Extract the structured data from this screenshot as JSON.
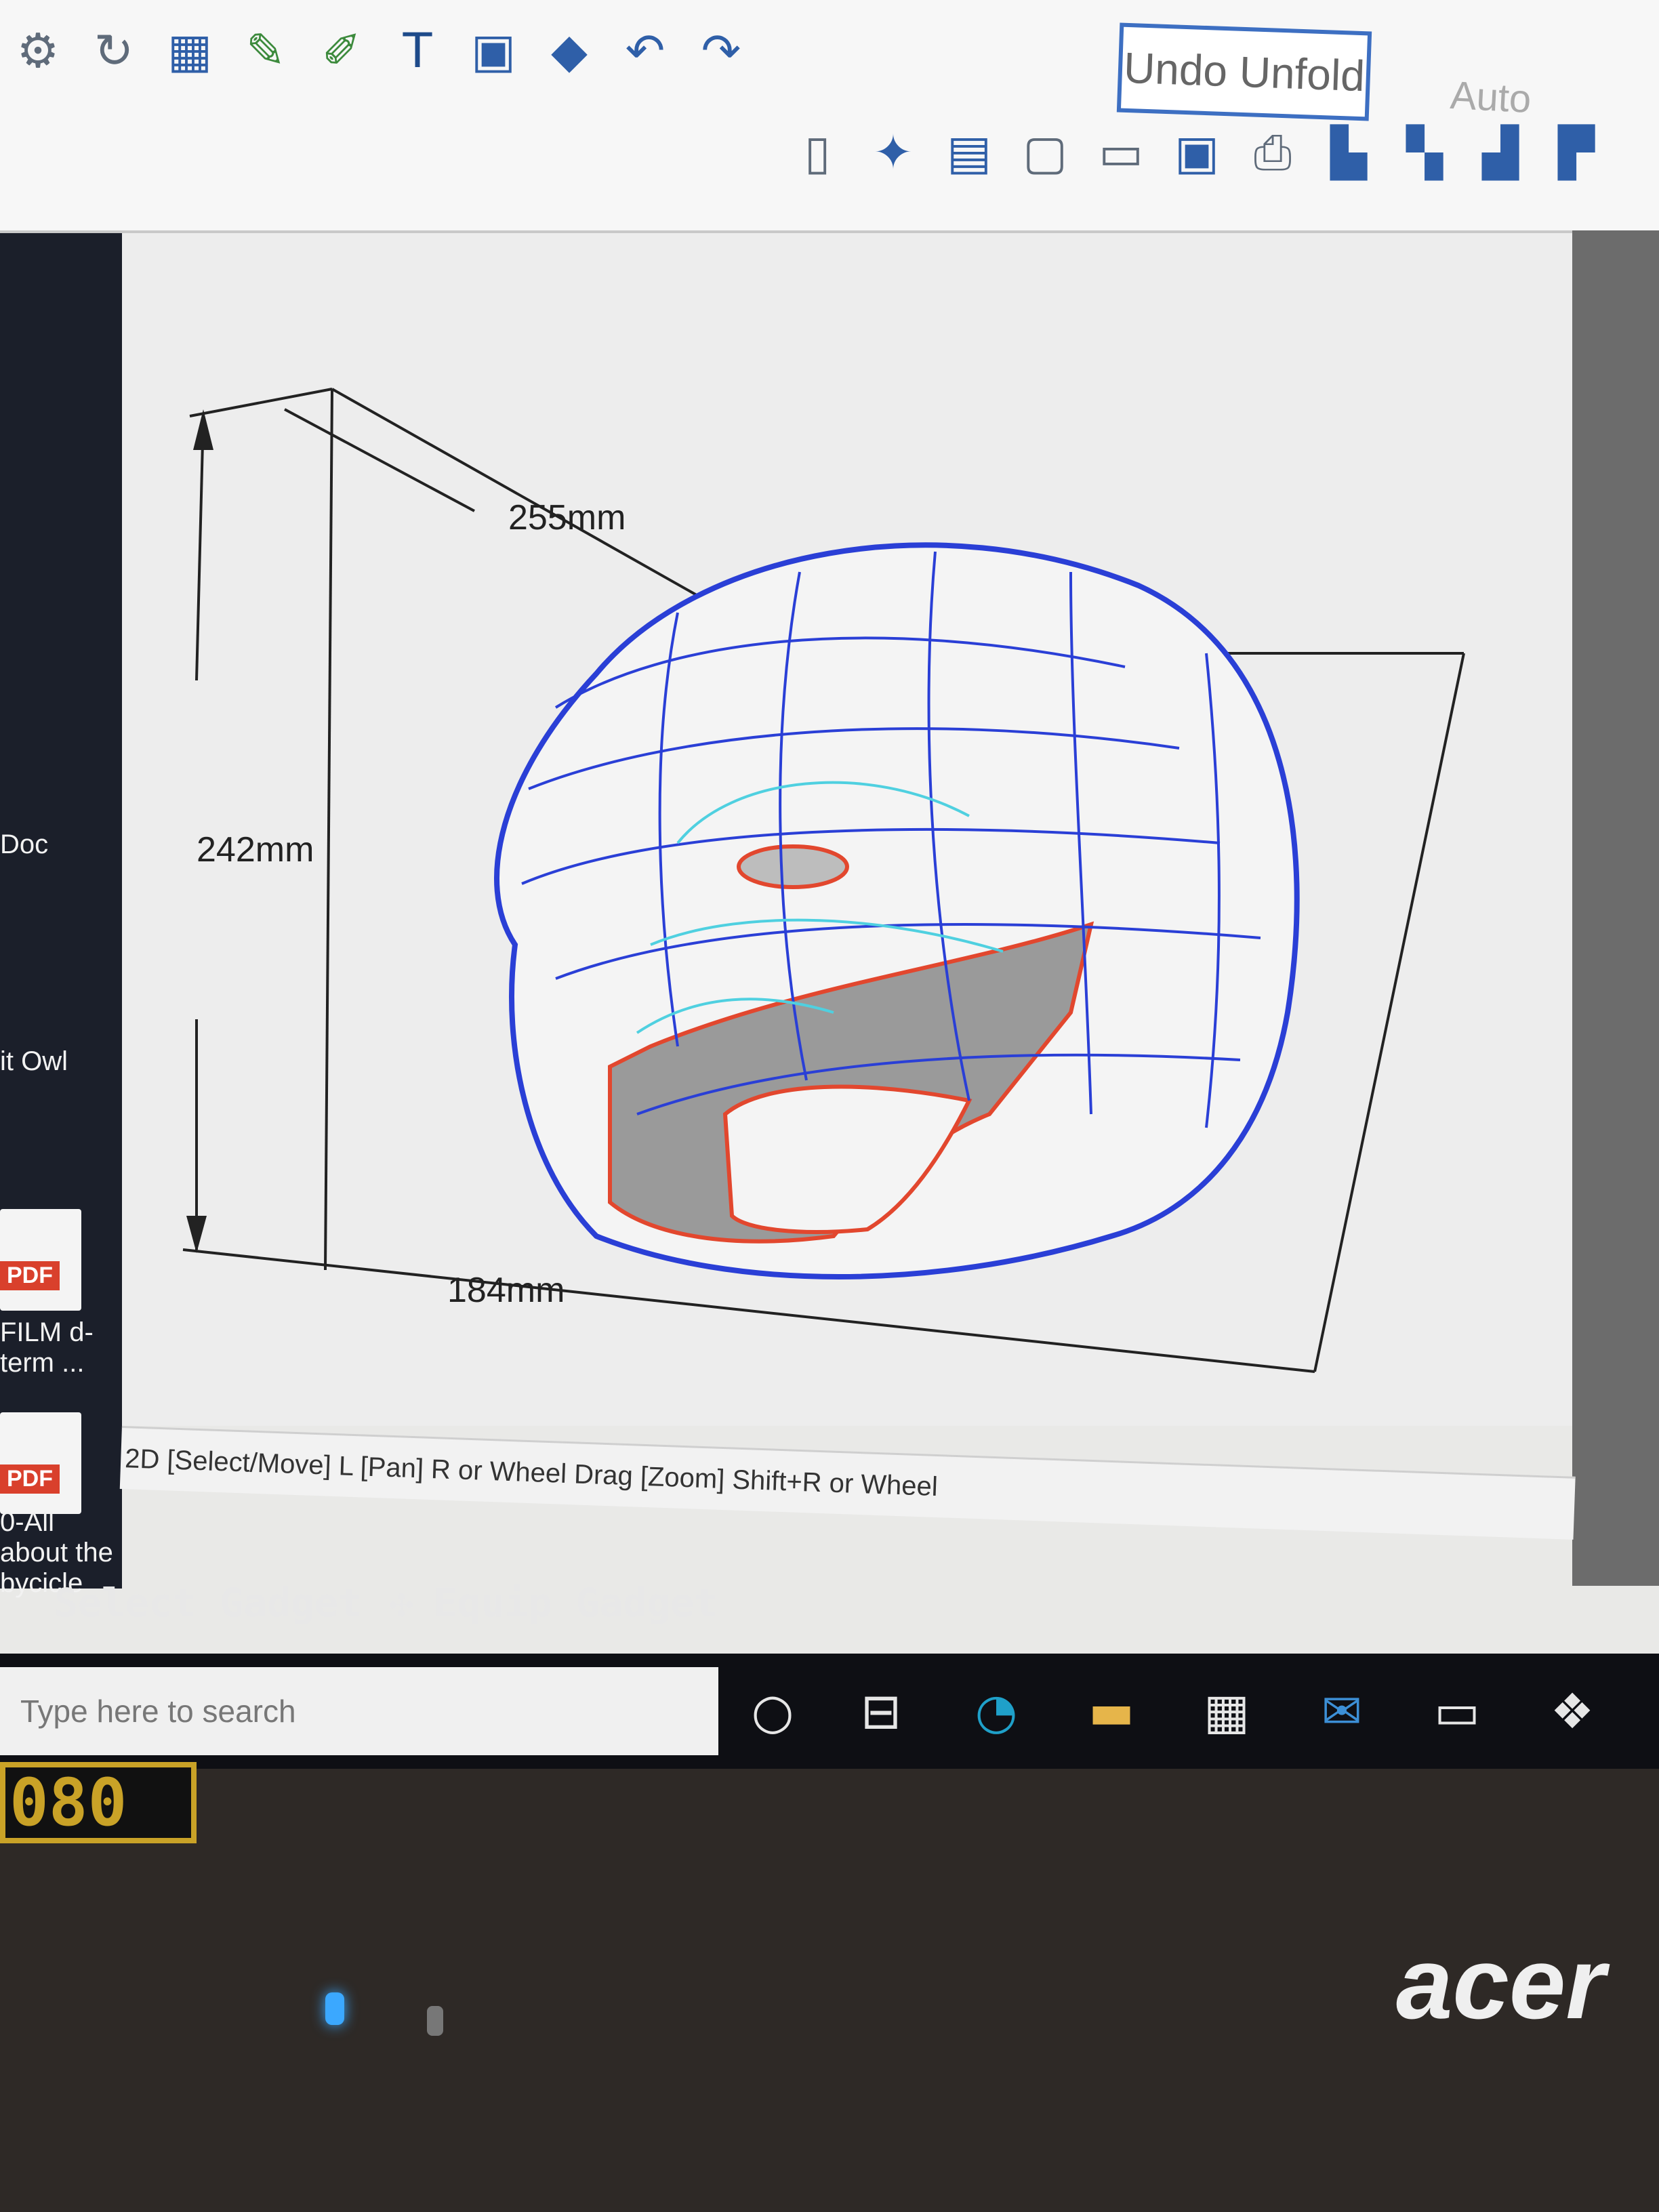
{
  "toolbar": {
    "undo_unfold_label": "Undo Unfold",
    "auto_label": "Auto",
    "row1_icons": [
      "pointer-icon",
      "rotate-icon",
      "grid-select-icon",
      "pencil-icon",
      "pencil-edit-icon",
      "text-icon",
      "image-icon",
      "cube-icon",
      "undo-icon",
      "redo-icon"
    ],
    "row2_icons": [
      "book-icon",
      "unfold-icon",
      "layout-icon",
      "page-icon",
      "page-export-icon",
      "page-object-icon",
      "print-icon",
      "align-left-icon",
      "align-center-icon",
      "align-right-icon",
      "align-top-icon"
    ]
  },
  "canvas": {
    "dim_width": "255mm",
    "dim_height": "242mm",
    "dim_depth": "184mm"
  },
  "statusbar": {
    "text": "2D [Select/Move] L [Pan] R or Wheel Drag [Zoom] Shift+R or Wheel"
  },
  "desktop": {
    "items": [
      {
        "label": "Doc"
      },
      {
        "label": "it Owl"
      },
      {
        "label": "FILM d-term ..."
      },
      {
        "label": "0-All about the bycicle"
      }
    ],
    "pdf_tag": "PDF"
  },
  "overlay": {
    "select_gadget": "Select Gadget",
    "equip_gadget": "Equip Gadget"
  },
  "taskbar": {
    "search_placeholder": "Type here to search"
  },
  "bezel": {
    "hz_badge": "080",
    "brand": "acer"
  },
  "colors": {
    "mesh_blue": "#2a3fd6",
    "mesh_cyan": "#4fd0e0",
    "mesh_red": "#e2472e"
  }
}
